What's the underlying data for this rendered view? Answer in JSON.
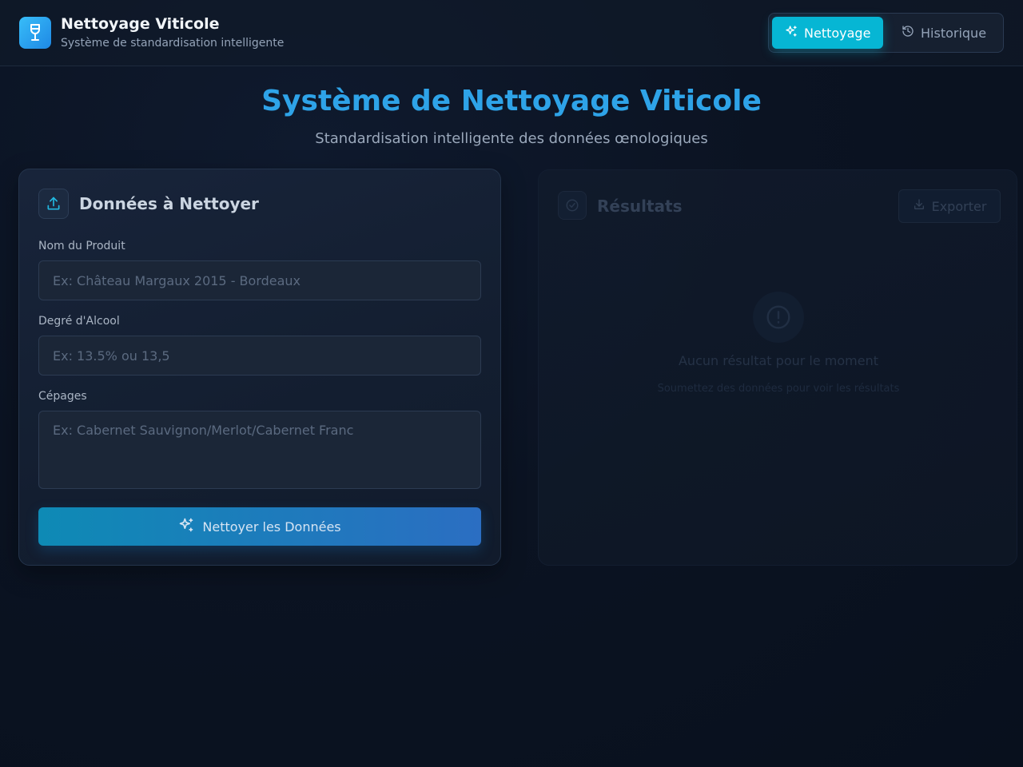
{
  "header": {
    "title": "Nettoyage Viticole",
    "subtitle": "Système de standardisation intelligente",
    "logo_icon": "wine-glass-icon",
    "nav": [
      {
        "label": "Nettoyage",
        "icon": "sparkles-icon",
        "active": true
      },
      {
        "label": "Historique",
        "icon": "history-icon",
        "active": false
      }
    ]
  },
  "hero": {
    "title": "Système de Nettoyage Viticole",
    "subtitle": "Standardisation intelligente des données œnologiques"
  },
  "form": {
    "title": "Données à Nettoyer",
    "icon": "upload-icon",
    "fields": {
      "product": {
        "label": "Nom du Produit",
        "placeholder": "Ex: Château Margaux 2015 - Bordeaux",
        "value": ""
      },
      "alcohol": {
        "label": "Degré d'Alcool",
        "placeholder": "Ex: 13.5% ou 13,5",
        "value": ""
      },
      "grapes": {
        "label": "Cépages",
        "placeholder": "Ex: Cabernet Sauvignon/Merlot/Cabernet Franc",
        "value": ""
      }
    },
    "submit_label": "Nettoyer les Données"
  },
  "results": {
    "title": "Résultats",
    "icon": "check-circle-icon",
    "export_label": "Exporter",
    "empty_title": "Aucun résultat pour le moment",
    "empty_subtitle": "Soumettez des données pour voir les résultats"
  },
  "colors": {
    "accent": "#06b6d4",
    "hero_title": "#2ea3e8",
    "background": "#0b1322"
  }
}
